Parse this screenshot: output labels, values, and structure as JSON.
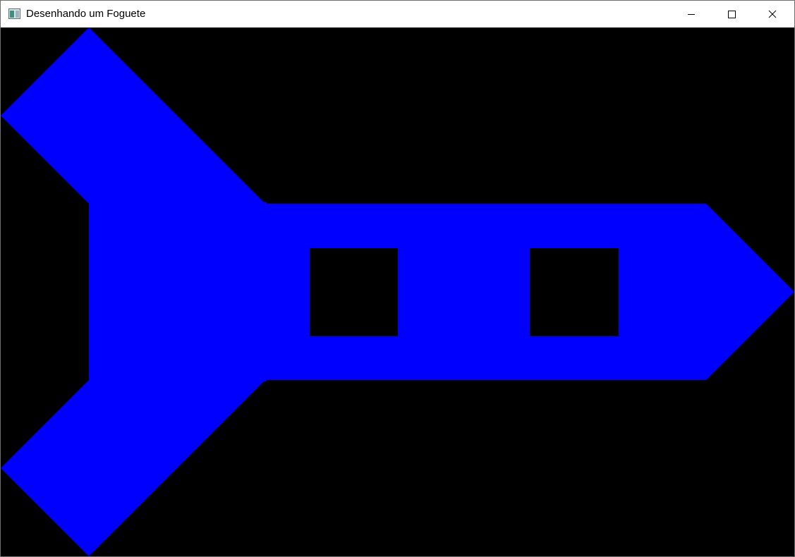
{
  "window": {
    "title": "Desenhando um Foguete",
    "controls": {
      "minimize_icon": "minimize-icon",
      "maximize_icon": "maximize-icon",
      "close_icon": "close-icon"
    }
  },
  "canvas": {
    "background_color": "#000000",
    "rocket": {
      "body_color": "#0000ff",
      "window_color": "#000000",
      "window_count": 2
    }
  }
}
